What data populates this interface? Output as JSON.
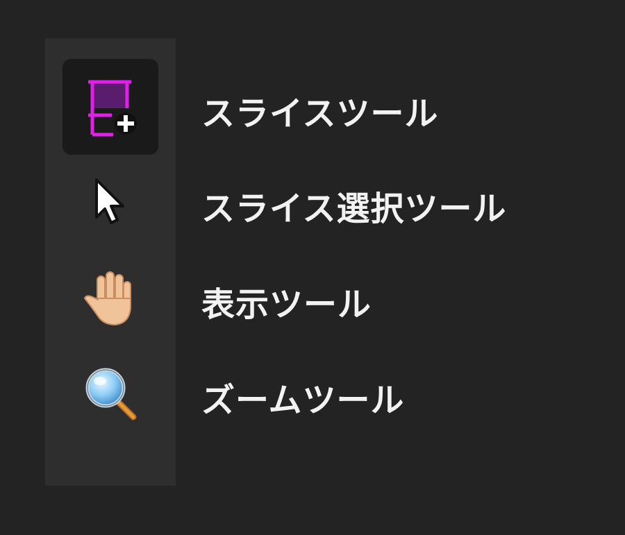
{
  "toolbar": {
    "tools": [
      {
        "id": "slice",
        "icon": "slice-tool-icon",
        "label": "スライスツール",
        "active": true
      },
      {
        "id": "slice-select",
        "icon": "arrow-cursor-icon",
        "label": "スライス選択ツール",
        "active": false
      },
      {
        "id": "hand",
        "icon": "hand-icon",
        "label": "表示ツール",
        "active": false
      },
      {
        "id": "zoom",
        "icon": "magnifier-icon",
        "label": "ズームツール",
        "active": false
      }
    ]
  },
  "colors": {
    "background": "#232323",
    "toolbar_bg": "#2e2e2e",
    "active_bg": "#1a1a1a",
    "slice_magenta": "#e020e8",
    "slice_fill": "#5a1d6e",
    "label_text": "#f2f2f2"
  }
}
